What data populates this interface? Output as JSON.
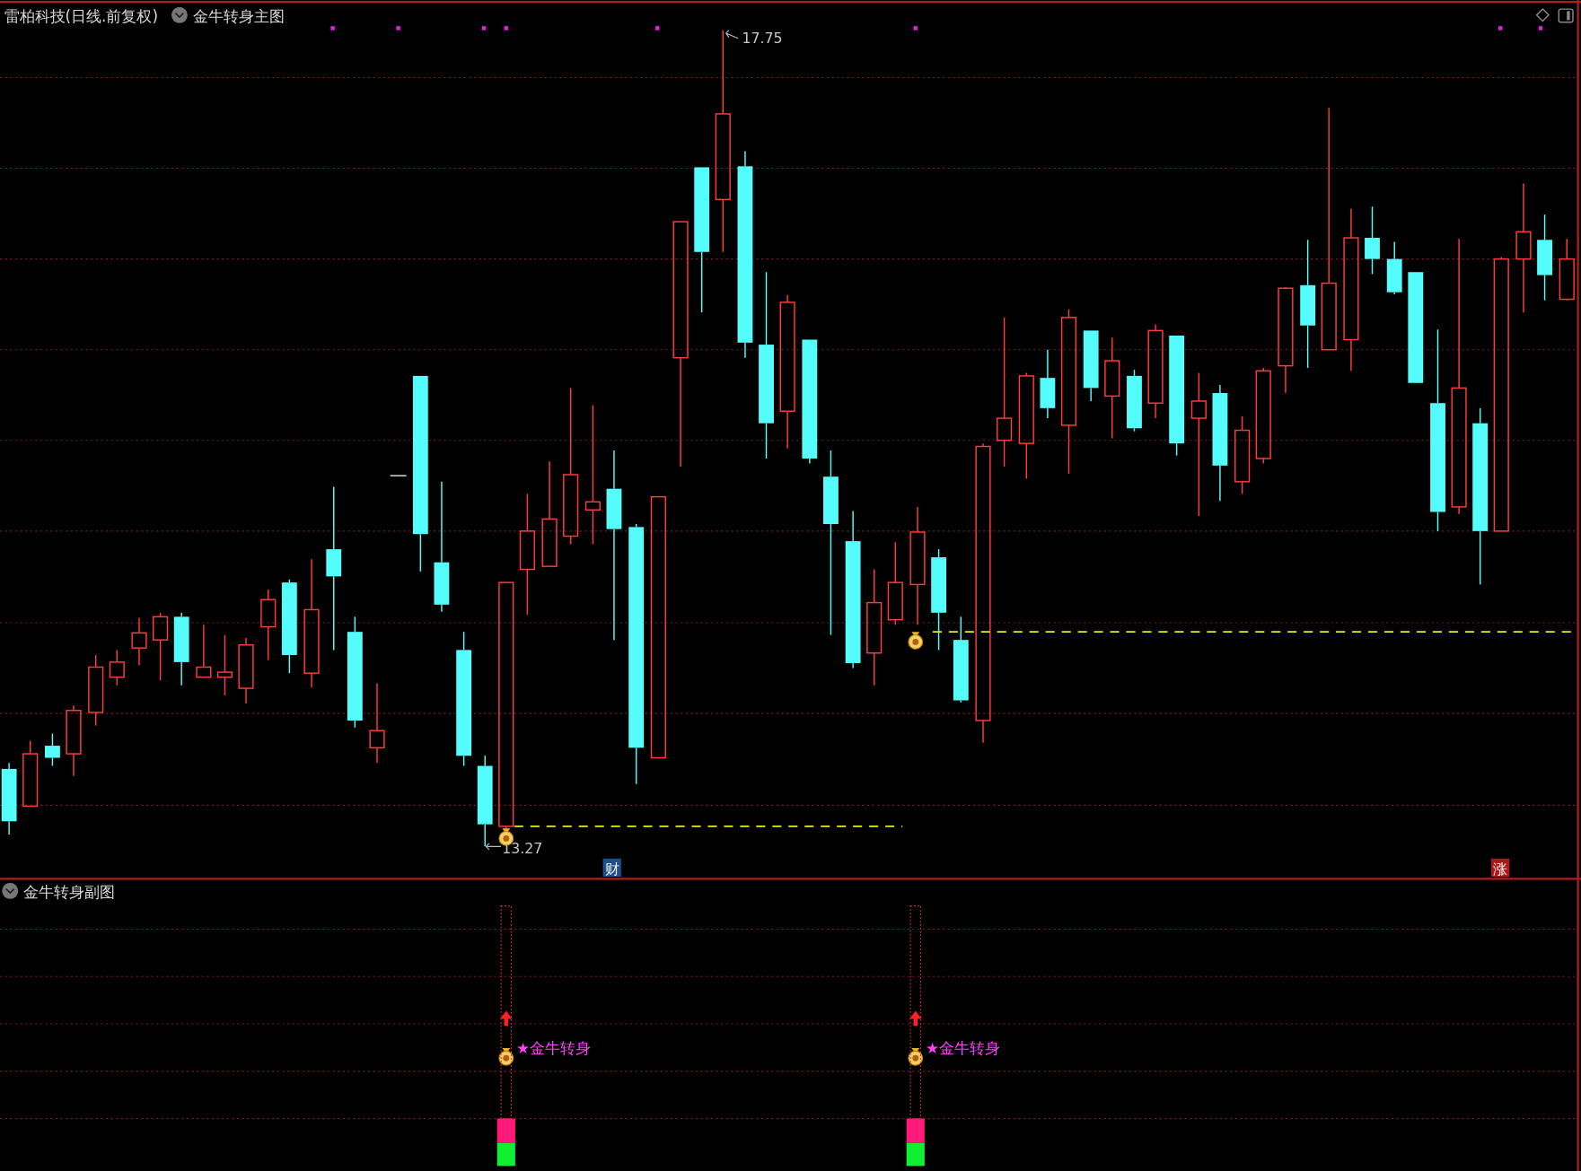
{
  "main_chart": {
    "title": "雷柏科技(日线.前复权)",
    "indicator": "金牛转身主图",
    "high_label": "17.75",
    "low_label": "13.27",
    "markers": [
      {
        "kind": "finance",
        "text": "财"
      },
      {
        "kind": "rise",
        "text": "涨"
      }
    ]
  },
  "sub_chart": {
    "title": "金牛转身副图",
    "signals": [
      {
        "label": "★金牛转身"
      },
      {
        "label": "★金牛转身"
      }
    ]
  }
}
